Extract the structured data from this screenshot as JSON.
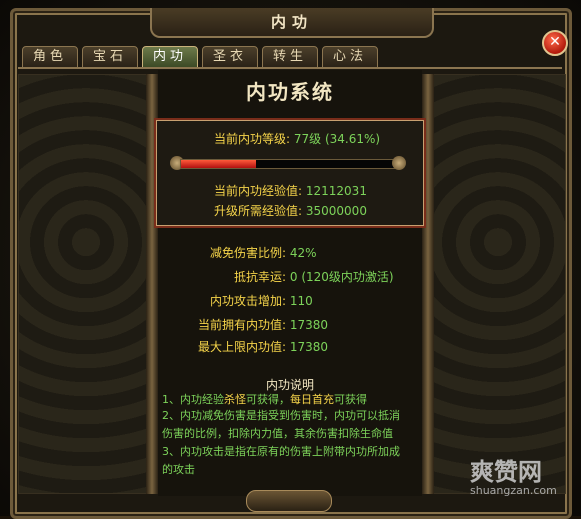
{
  "window": {
    "title": "内功",
    "close_label": "✕"
  },
  "tabs": [
    {
      "label": "角色",
      "active": false
    },
    {
      "label": "宝石",
      "active": false
    },
    {
      "label": "内功",
      "active": true
    },
    {
      "label": "圣衣",
      "active": false
    },
    {
      "label": "转生",
      "active": false
    },
    {
      "label": "心法",
      "active": false
    }
  ],
  "system": {
    "title": "内功系统",
    "level_label": "当前内功等级:",
    "level_value": "77级 (34.61%)",
    "progress": 0.3461,
    "exp_label": "当前内功经验值:",
    "exp_value": "12112031",
    "next_exp_label": "升级所需经验值:",
    "next_exp_value": "35000000"
  },
  "stats": [
    {
      "label": "减免伤害比例:",
      "value": "42%"
    },
    {
      "label": "抵抗幸运:",
      "value": "0 (120级内功激活)"
    },
    {
      "label": "内功攻击增加:",
      "value": "110"
    },
    {
      "label": "当前拥有内功值:",
      "value": "17380"
    },
    {
      "label": "最大上限内功值:",
      "value": "17380"
    }
  ],
  "description": {
    "title": "内功说明",
    "line1a": "1、内功经验",
    "line1b": "杀怪",
    "line1c": "可获得，",
    "line1d": "每日首充",
    "line1e": "可获得",
    "line2": "2、内功减免伤害是指受到伤害时，内功可以抵消",
    "line3": "伤害的比例，扣除内力值，其余伤害扣除生命值",
    "line4": "3、内功攻击是指在原有的伤害上附带内功所加成",
    "line5": "的攻击"
  },
  "watermark": {
    "brand": "爽赞网",
    "url": "shuangzan.com"
  },
  "colors": {
    "label": "#f5d44a",
    "value": "#7dd35a",
    "accent_red": "#b01010"
  }
}
